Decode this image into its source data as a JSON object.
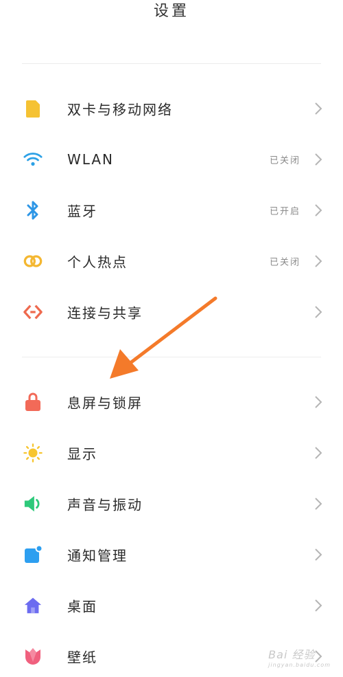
{
  "header": {
    "title": "设置"
  },
  "group1": [
    {
      "label": "双卡与移动网络",
      "status": "",
      "icon": "sim-card-icon",
      "color": "#f5c233"
    },
    {
      "label": "WLAN",
      "status": "已关闭",
      "icon": "wifi-icon",
      "color": "#2da1e6"
    },
    {
      "label": "蓝牙",
      "status": "已开启",
      "icon": "bluetooth-icon",
      "color": "#2d96e6"
    },
    {
      "label": "个人热点",
      "status": "已关闭",
      "icon": "hotspot-icon",
      "color": "#f4b731"
    },
    {
      "label": "连接与共享",
      "status": "",
      "icon": "connection-sharing-icon",
      "color": "#ee6a4f"
    }
  ],
  "group2": [
    {
      "label": "息屏与锁屏",
      "status": "",
      "icon": "lock-icon",
      "color": "#f26a58"
    },
    {
      "label": "显示",
      "status": "",
      "icon": "sun-icon",
      "color": "#f7c52f"
    },
    {
      "label": "声音与振动",
      "status": "",
      "icon": "speaker-icon",
      "color": "#2dc97a"
    },
    {
      "label": "通知管理",
      "status": "",
      "icon": "notification-icon",
      "color": "#2d9ff0"
    },
    {
      "label": "桌面",
      "status": "",
      "icon": "home-icon",
      "color": "#6c6cf0"
    },
    {
      "label": "壁纸",
      "status": "",
      "icon": "tulip-icon",
      "color": "#f0607e"
    }
  ],
  "annotation": {
    "arrow_color": "#f47a2a"
  },
  "watermark": {
    "text": "Bai 经验",
    "sub": "jingyan.baidu.com"
  }
}
